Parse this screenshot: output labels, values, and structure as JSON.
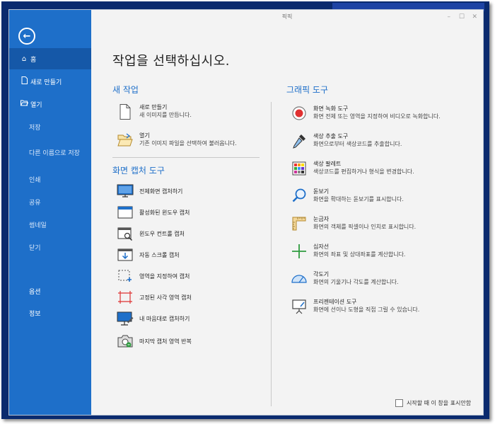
{
  "window": {
    "title": "픽픽",
    "minimize": "–",
    "maximize": "☐",
    "close": "✕"
  },
  "sidebar": {
    "back_icon": "←",
    "items": [
      {
        "label": "홈",
        "icon": "home-icon",
        "glyph": "⌂"
      },
      {
        "label": "새로 만들기",
        "icon": "new-file-icon",
        "glyph": "🗋"
      },
      {
        "label": "열기",
        "icon": "open-folder-icon",
        "glyph": "🗁"
      },
      {
        "label": "저장"
      },
      {
        "label": "다른 이름으로 저장"
      },
      {
        "label": "인쇄"
      },
      {
        "label": "공유"
      },
      {
        "label": "썸네일"
      },
      {
        "label": "닫기"
      },
      {
        "label": "옵션"
      },
      {
        "label": "정보"
      }
    ]
  },
  "main": {
    "page_title": "작업을 선택하십시오.",
    "new_task": {
      "title": "새 작업",
      "items": [
        {
          "title": "새로 만들기",
          "desc": "새 이미지를 만듭니다."
        },
        {
          "title": "열기",
          "desc": "기존 이미지 파일을 선택하여 불러옵니다."
        }
      ]
    },
    "capture": {
      "title": "화면 캡처 도구",
      "items": [
        "전체화면 캡처하기",
        "활성화된 윈도우 캡처",
        "윈도우 컨트롤 캡처",
        "자동 스크롤 캡처",
        "영역을 지정하여 캡처",
        "고정된 사각 영역 캡처",
        "내 마음대로 캡처하기",
        "마지막 캡처 영역 반복"
      ]
    },
    "graphic": {
      "title": "그래픽 도구",
      "items": [
        {
          "title": "화면 녹화 도구",
          "desc": "화면 전체 또는 영역을 지정하여 비디오로 녹화합니다."
        },
        {
          "title": "색상 추출 도구",
          "desc": "화면으로부터 색상코드를 추출합니다."
        },
        {
          "title": "색상 팔레트",
          "desc": "색상코드를 편집하거나 형식을 변경합니다."
        },
        {
          "title": "돋보기",
          "desc": "화면을 확대하는 돋보기를 표시합니다."
        },
        {
          "title": "눈금자",
          "desc": "화면의 객체를 픽셀이나 인치로 표시합니다."
        },
        {
          "title": "십자선",
          "desc": "화면의 좌표 및 상대좌표를 계산합니다."
        },
        {
          "title": "각도기",
          "desc": "화면의 기울기나 각도를 계산합니다."
        },
        {
          "title": "프리젠테이션 도구",
          "desc": "화면에 선이나 도형을 직접 그릴 수 있습니다."
        }
      ]
    },
    "startup_checkbox": {
      "label": "시작할 때 이 창을 표시안함",
      "checked": false
    }
  }
}
